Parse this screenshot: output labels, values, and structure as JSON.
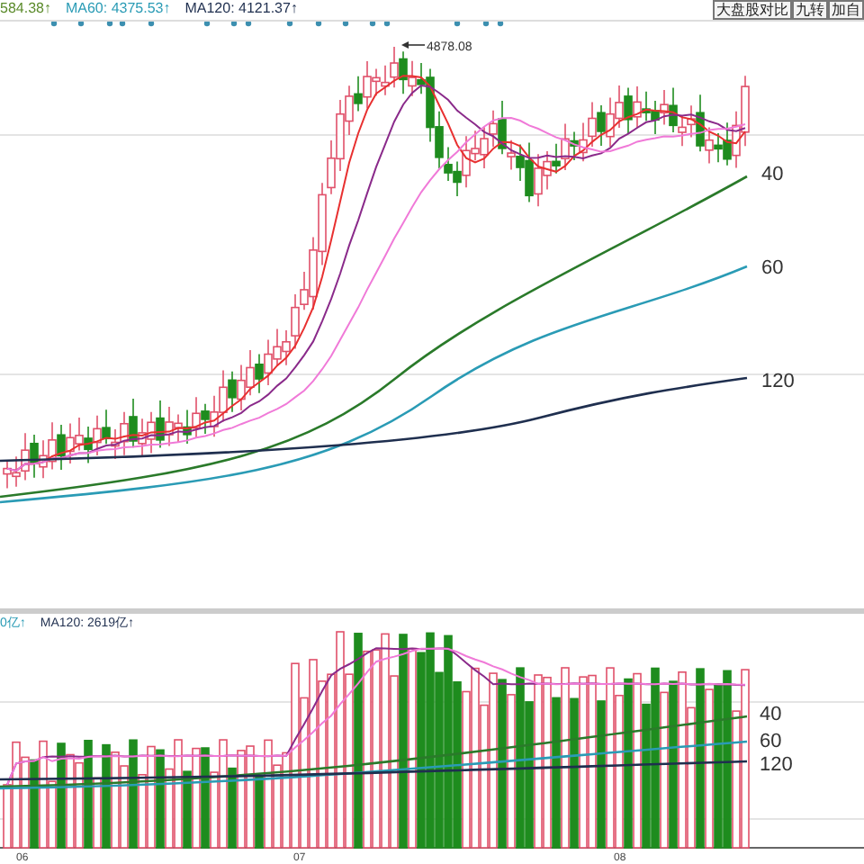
{
  "price_legend": [
    {
      "text": "584.38↑",
      "color": "#5a8a2a"
    },
    {
      "text": "MA60: 4375.53↑",
      "color": "#2a9bb5"
    },
    {
      "text": "MA120: 4121.37↑",
      "color": "#1f2f4f"
    }
  ],
  "toolbar_buttons": [
    "大盘股对比",
    "九转",
    "加自"
  ],
  "peak_label": "4878.08",
  "price_ma_labels": [
    "40",
    "60",
    "120"
  ],
  "volume_legend": [
    {
      "text": "0亿↑",
      "color": "#2a9bb5"
    },
    {
      "text": "MA120: 2619亿↑",
      "color": "#1f2f4f"
    }
  ],
  "volume_ma_labels": [
    "40",
    "60",
    "120"
  ],
  "x_axis_labels": [
    "06",
    "07",
    "08"
  ]
}
